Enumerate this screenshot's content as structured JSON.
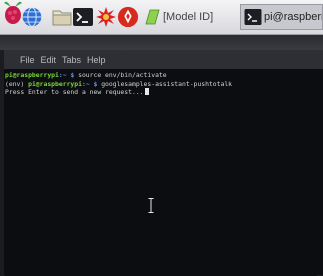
{
  "taskbar": {
    "icons": [
      "raspberry-icon",
      "globe-icon",
      "folder-icon",
      "terminal-icon",
      "burst-icon",
      "wolfram-icon"
    ],
    "tasks": [
      {
        "label": "[Model ID]",
        "icon": "tab-icon"
      },
      {
        "label": "pi@raspberrypi",
        "icon": "terminal-icon"
      }
    ]
  },
  "menu": [
    "File",
    "Edit",
    "Tabs",
    "Help"
  ],
  "terminal": {
    "lines": [
      {
        "user": "pi@raspberrypi",
        "path": ":~ $",
        "cmd": " source env/bin/activate"
      },
      {
        "prefix": "(env) ",
        "user": "pi@raspberrypi",
        "path": ":~ $",
        "cmd": " googlesamples-assistant-pushtotalk"
      },
      {
        "text": "Press Enter to send a new request..."
      }
    ]
  },
  "colors": {
    "prompt_user": "#7ad63c",
    "prompt_path": "#6c8ef0",
    "text": "#d2d3d6",
    "background": "#0c0d10"
  }
}
